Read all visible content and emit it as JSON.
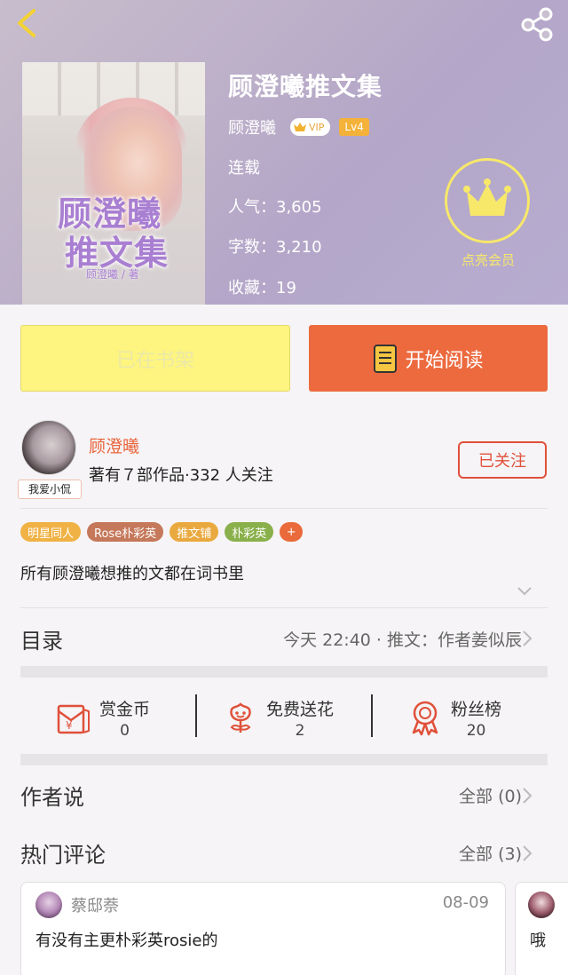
{
  "header": {
    "book_title": "顾澄曦推文集",
    "author": "顾澄曦",
    "vip_label": "VIP",
    "level": "Lv4",
    "status": "连载",
    "popularity": "人气：3,605",
    "word_count": "字数：3,210",
    "favorites": "收藏：19",
    "member_label": "点亮会员",
    "cover": {
      "title_line1": "顾澄曦",
      "title_line2": "推文集",
      "author_credit": "顾澄曦 / 著"
    }
  },
  "actions": {
    "shelf_label": "已在书架",
    "read_label": "开始阅读"
  },
  "author_section": {
    "avatar_tag": "我爱小侃",
    "name": "顾澄曦",
    "meta": "著有７部作品·332 人关注",
    "follow_label": "已关注"
  },
  "tags": [
    "明星同人",
    "Rose朴彩英",
    "推文铺",
    "朴彩英",
    "+"
  ],
  "description": "所有顾澄曦想推的文都在词书里",
  "toc": {
    "label": "目录",
    "latest": "今天 22:40 · 推文：作者姜似辰"
  },
  "rewards": [
    {
      "name": "赏金币",
      "count": "0",
      "icon": "red-envelope-icon"
    },
    {
      "name": "免费送花",
      "count": "2",
      "icon": "flower-icon"
    },
    {
      "name": "粉丝榜",
      "count": "20",
      "icon": "medal-icon"
    }
  ],
  "author_says": {
    "title": "作者说",
    "more": "全部 (0)"
  },
  "hot_comments": {
    "title": "热门评论",
    "more": "全部 (3)",
    "items": [
      {
        "user": "蔡邸萘",
        "date": "08-09",
        "text": "有没有主更朴彩英rosie的"
      },
      {
        "user": "",
        "date": "",
        "text": "哦"
      }
    ]
  },
  "colors": {
    "accent_orange": "#ed6a3f",
    "shelf_yellow": "#fdf57f",
    "member_yellow": "#f7e86a",
    "follow_red": "#e0503a"
  }
}
